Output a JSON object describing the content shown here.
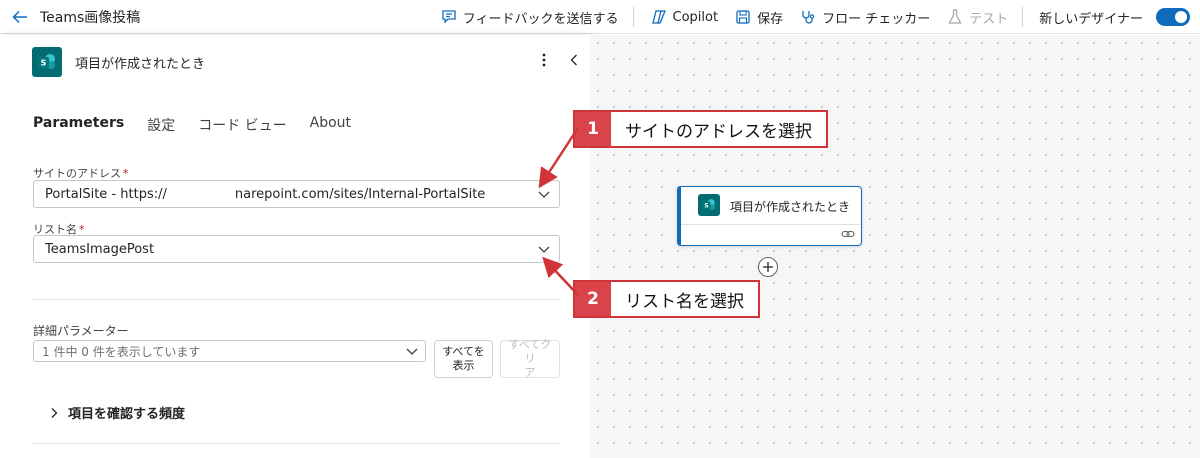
{
  "header": {
    "title": "Teams画像投稿",
    "feedback": "フィードバックを送信する",
    "copilot": "Copilot",
    "save": "保存",
    "flow_checker": "フロー チェッカー",
    "test": "テスト",
    "new_designer": "新しいデザイナー",
    "new_designer_enabled": true
  },
  "panel": {
    "title": "項目が作成されたとき",
    "logo_letter": "S",
    "tabs": [
      "Parameters",
      "設定",
      "コード ビュー",
      "About"
    ],
    "active_tab": "Parameters",
    "site_address": {
      "label": "サイトのアドレス",
      "required": "*",
      "value_prefix": "PortalSite - https://",
      "value_suffix": "narepoint.com/sites/Internal-PortalSite"
    },
    "list_name": {
      "label": "リスト名",
      "required": "*",
      "value": "TeamsImagePost"
    },
    "advanced": {
      "label": "詳細パラメーター",
      "placeholder": "1 件中 0 件を表示しています",
      "show_all_line1": "すべてを",
      "show_all_line2": "表示",
      "clear_all_line1": "すべてクリ",
      "clear_all_line2": "ア"
    },
    "expander": "項目を確認する頻度"
  },
  "canvas": {
    "node_title": "項目が作成されたとき",
    "node_logo_letter": "S"
  },
  "callouts": [
    {
      "num": "1",
      "text": "サイトのアドレスを選択"
    },
    {
      "num": "2",
      "text": "リスト名を選択"
    }
  ],
  "colors": {
    "accent": "#0f6cbd",
    "sharepoint": "#036c70",
    "callout": "#d9434a"
  }
}
